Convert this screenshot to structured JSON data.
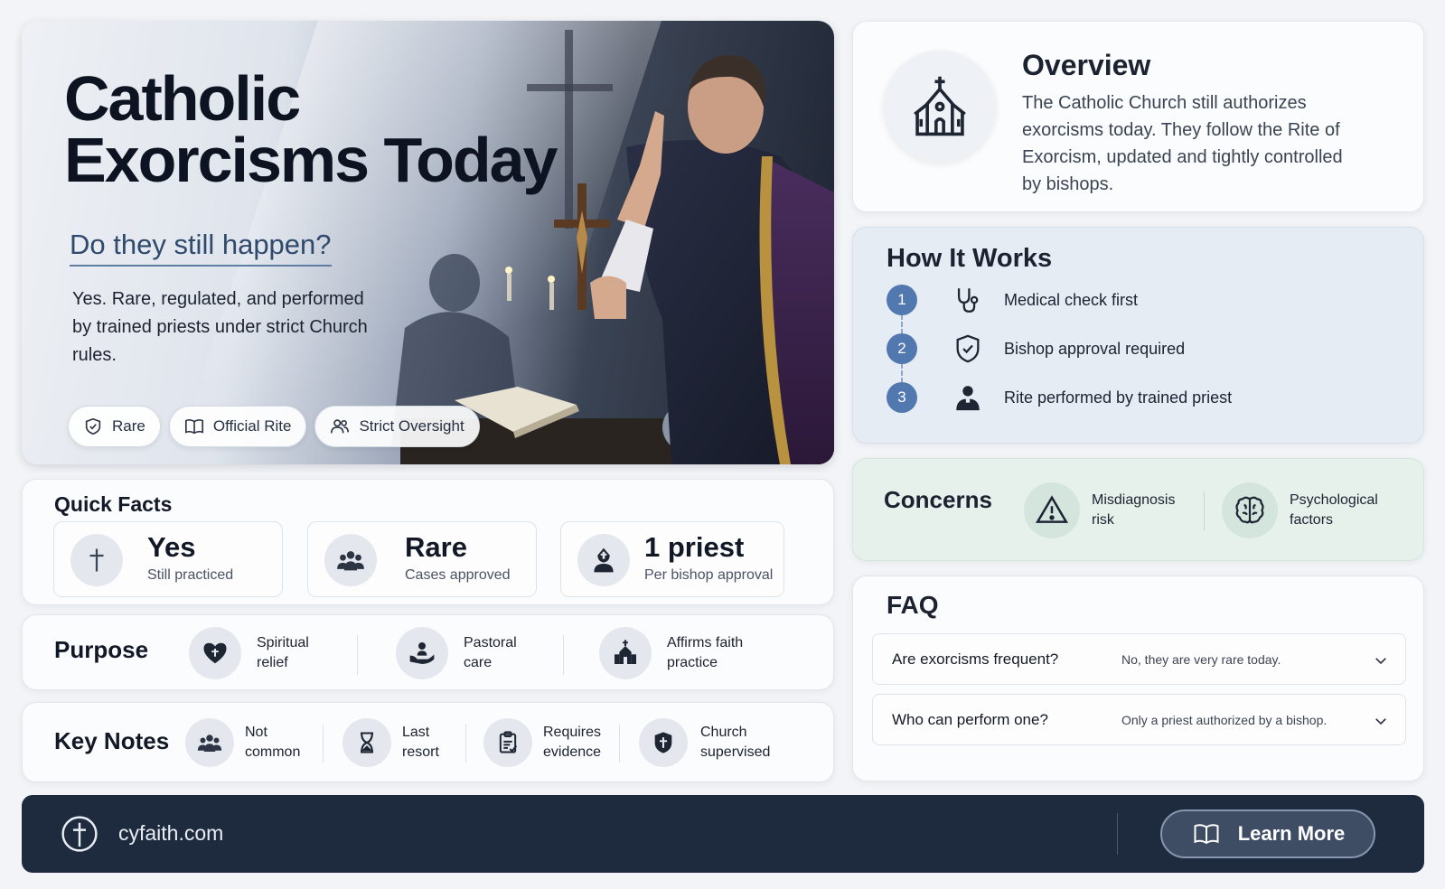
{
  "hero": {
    "title_line1": "Catholic",
    "title_line2": "Exorcisms Today",
    "subtitle": "Do they still happen?",
    "description": "Yes. Rare, regulated, and performed by trained priests under strict Church rules.",
    "tags": [
      "Rare",
      "Official Rite",
      "Strict Oversight"
    ]
  },
  "quick_facts": {
    "title": "Quick Facts",
    "items": [
      {
        "big": "Yes",
        "small": "Still practiced",
        "icon": "cross-icon"
      },
      {
        "big": "Rare",
        "small": "Cases approved",
        "icon": "group-icon"
      },
      {
        "big": "1 priest",
        "small": "Per bishop approval",
        "icon": "bishop-icon"
      }
    ]
  },
  "purpose": {
    "title": "Purpose",
    "items": [
      {
        "label_1": "Spiritual",
        "label_2": "relief",
        "icon": "heart-cross-icon"
      },
      {
        "label_1": "Pastoral",
        "label_2": "care",
        "icon": "care-hands-icon"
      },
      {
        "label_1": "Affirms faith",
        "label_2": "practice",
        "icon": "church-icon"
      }
    ]
  },
  "key_notes": {
    "title": "Key Notes",
    "items": [
      {
        "label_1": "Not",
        "label_2": "common",
        "icon": "group-icon"
      },
      {
        "label_1": "Last",
        "label_2": "resort",
        "icon": "hourglass-icon"
      },
      {
        "label_1": "Requires",
        "label_2": "evidence",
        "icon": "clipboard-icon"
      },
      {
        "label_1": "Church",
        "label_2": "supervised",
        "icon": "shield-cross-icon"
      }
    ]
  },
  "overview": {
    "title": "Overview",
    "text": "The Catholic Church still authorizes exorcisms today. They follow the Rite of Exorcism, updated and tightly controlled by bishops."
  },
  "how_it_works": {
    "title": "How It Works",
    "steps": [
      {
        "num": "1",
        "text": "Medical check first",
        "icon": "stethoscope-icon"
      },
      {
        "num": "2",
        "text": "Bishop approval required",
        "icon": "shield-check-icon"
      },
      {
        "num": "3",
        "text": "Rite performed by trained priest",
        "icon": "priest-icon"
      }
    ]
  },
  "concerns": {
    "title": "Concerns",
    "items": [
      {
        "label_1": "Misdiagnosis",
        "label_2": "risk",
        "icon": "warning-icon"
      },
      {
        "label_1": "Psychological",
        "label_2": "factors",
        "icon": "brain-icon"
      }
    ]
  },
  "faq": {
    "title": "FAQ",
    "items": [
      {
        "q": "Are exorcisms frequent?",
        "a": "No, they are very rare today."
      },
      {
        "q": "Who can perform one?",
        "a": "Only a priest authorized by a bishop."
      }
    ]
  },
  "footer": {
    "site": "cyfaith.com",
    "button": "Learn More"
  }
}
